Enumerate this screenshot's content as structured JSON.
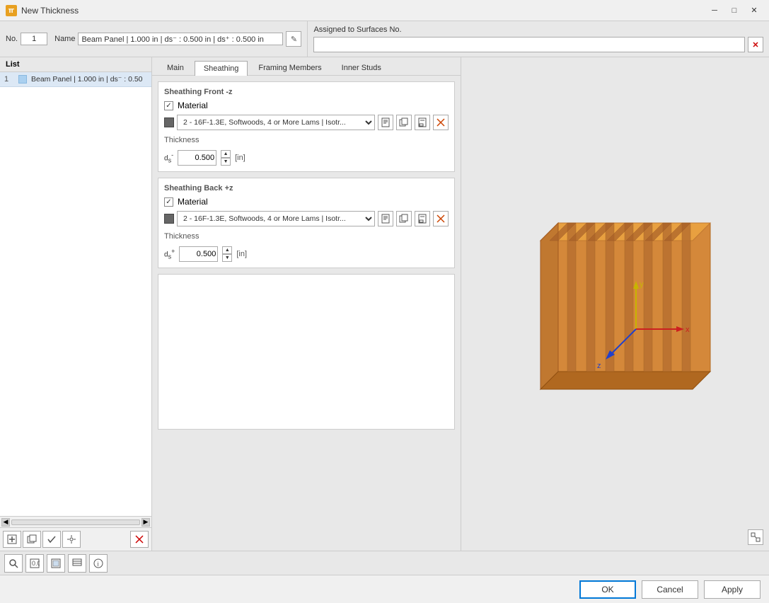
{
  "titleBar": {
    "title": "New Thickness",
    "icon": "thickness-icon"
  },
  "header": {
    "noLabel": "No.",
    "noValue": "1",
    "nameLabel": "Name",
    "nameValue": "Beam Panel | 1.000 in | ds⁻ : 0.500 in | ds⁺ : 0.500 in",
    "assignedLabel": "Assigned to Surfaces No.",
    "assignedValue": ""
  },
  "tabs": [
    {
      "id": "main",
      "label": "Main",
      "active": false
    },
    {
      "id": "sheathing",
      "label": "Sheathing",
      "active": true
    },
    {
      "id": "framing",
      "label": "Framing Members",
      "active": false
    },
    {
      "id": "inner",
      "label": "Inner Studs",
      "active": false
    }
  ],
  "sheathing": {
    "frontSection": {
      "title": "Sheathing Front -z",
      "materialChecked": true,
      "materialLabel": "Material",
      "materialValue": "2 - 16F-1.3E, Softwoods, 4 or More Lams | Isotr...",
      "thicknessLabel": "Thickness",
      "dsLabel": "ds⁻",
      "dsValue": "0.500",
      "unitLabel": "[in]"
    },
    "backSection": {
      "title": "Sheathing Back +z",
      "materialChecked": true,
      "materialLabel": "Material",
      "materialValue": "2 - 16F-1.3E, Softwoods, 4 or More Lams | Isotr...",
      "thicknessLabel": "Thickness",
      "dsLabel": "ds⁺",
      "dsValue": "0.500",
      "unitLabel": "[in]"
    }
  },
  "listPanel": {
    "header": "List",
    "items": [
      {
        "num": "1",
        "text": "Beam Panel | 1.000 in | ds⁻ : 0.50"
      }
    ]
  },
  "bottomToolbar": {
    "buttons": [
      "new",
      "copy",
      "check",
      "settings",
      "delete"
    ]
  },
  "footerButtons": {
    "ok": "OK",
    "cancel": "Cancel",
    "apply": "Apply"
  },
  "icons": {
    "book": "📖",
    "copy": "⧉",
    "export": "↗",
    "delete": "✕",
    "edit": "✎",
    "new": "□",
    "check": "✓",
    "settings": "⚙",
    "clear": "✕",
    "spinUp": "▲",
    "spinDown": "▼",
    "cornerExpand": "⤢"
  }
}
